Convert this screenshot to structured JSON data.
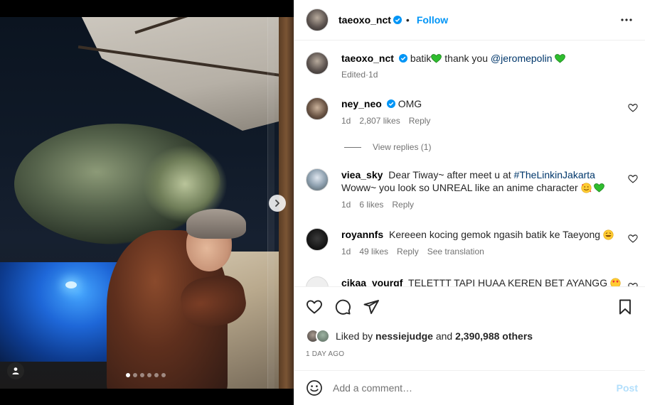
{
  "post": {
    "username": "taeoxo_nct",
    "follow_label": "Follow",
    "separator": "•",
    "carousel": {
      "total_slides": 6,
      "active_slide": 1
    }
  },
  "caption": {
    "username": "taeoxo_nct",
    "text_part1": "batik",
    "text_part2": " thank you ",
    "mention": "@jeromepolin",
    "meta_edited": "Edited",
    "meta_sep": " · ",
    "meta_time": "1d"
  },
  "comments": [
    {
      "username": "ney_neo",
      "verified": true,
      "text": "OMG",
      "time": "1d",
      "likes": "2,807 likes",
      "reply": "Reply",
      "view_replies": "View replies (1)"
    },
    {
      "username": "viea_sky",
      "verified": false,
      "text_line1": "Dear Tiway~ after meet u at ",
      "hashtag": "#TheLinkinJakarta",
      "text_line2": "Woww~ you look so UNREAL like an anime character",
      "time": "1d",
      "likes": "6 likes",
      "reply": "Reply"
    },
    {
      "username": "royannfs",
      "verified": false,
      "text": "Kereeen kocing gemok ngasih batik ke Taeyong",
      "time": "1d",
      "likes": "49 likes",
      "reply": "Reply",
      "see_translation": "See translation"
    },
    {
      "username": "cikaa_yourgf",
      "verified": false,
      "text": "TELETTT TAPI HUAA KEREN BET AYANGG"
    }
  ],
  "likes_summary": {
    "prefix": "Liked by ",
    "user": "nessiejudge",
    "middle": " and ",
    "count": "2,390,988 others"
  },
  "date_label": "1 day ago",
  "add_comment": {
    "placeholder": "Add a comment…",
    "post_label": "Post"
  },
  "colors": {
    "link_blue": "#0095f6",
    "verified_blue": "#0095f6",
    "heart_green": "#2ebd2e",
    "muted": "#737373"
  }
}
